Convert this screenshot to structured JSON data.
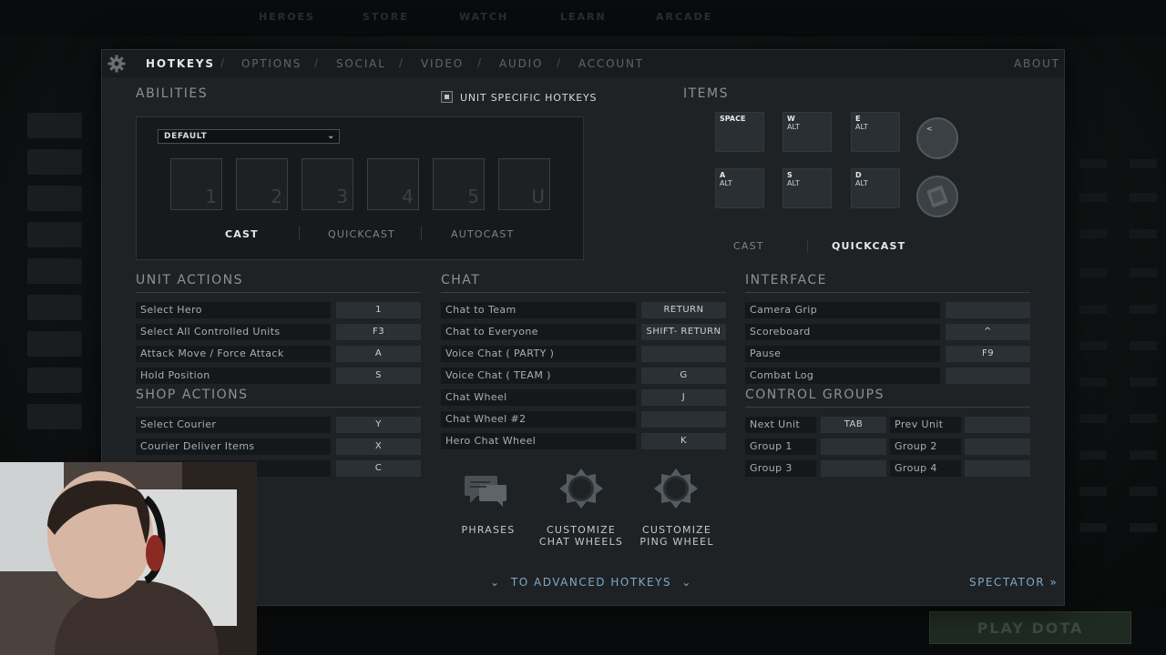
{
  "background": {
    "nav": [
      "HEROES",
      "STORE",
      "WATCH",
      "LEARN",
      "ARCADE"
    ],
    "play_label": "PLAY DOTA"
  },
  "tabs": [
    "HOTKEYS",
    "OPTIONS",
    "SOCIAL",
    "VIDEO",
    "AUDIO",
    "ACCOUNT"
  ],
  "about": "ABOUT",
  "abilities": {
    "title": "ABILITIES",
    "unit_specific": "UNIT SPECIFIC HOTKEYS",
    "preset": "DEFAULT",
    "slots": [
      "1",
      "2",
      "3",
      "4",
      "5",
      "U"
    ],
    "modes": [
      "CAST",
      "QUICKCAST",
      "AUTOCAST"
    ]
  },
  "items": {
    "title": "ITEMS",
    "slots": [
      {
        "key": "SPACE",
        "mod": ""
      },
      {
        "key": "W",
        "mod": "ALT"
      },
      {
        "key": "E",
        "mod": "ALT"
      },
      {
        "key": "A",
        "mod": "ALT"
      },
      {
        "key": "S",
        "mod": "ALT"
      },
      {
        "key": "D",
        "mod": "ALT"
      }
    ],
    "special_key": "<",
    "modes": [
      "CAST",
      "QUICKCAST"
    ]
  },
  "unit_actions": {
    "title": "UNIT ACTIONS",
    "rows": [
      {
        "name": "Select Hero",
        "key": "1"
      },
      {
        "name": "Select All Controlled Units",
        "key": "F3"
      },
      {
        "name": "Attack Move / Force Attack",
        "key": "A"
      },
      {
        "name": "Hold Position",
        "key": "S"
      }
    ]
  },
  "shop_actions": {
    "title": "SHOP ACTIONS",
    "rows": [
      {
        "name": "Select Courier",
        "key": "Y"
      },
      {
        "name": "Courier Deliver Items",
        "key": "X"
      },
      {
        "name": "",
        "key": "C"
      }
    ]
  },
  "chat": {
    "title": "CHAT",
    "rows": [
      {
        "name": "Chat to Team",
        "key": "RETURN"
      },
      {
        "name": "Chat to Everyone",
        "key": "SHIFT- RETURN"
      },
      {
        "name": "Voice Chat ( PARTY )",
        "key": ""
      },
      {
        "name": "Voice Chat ( TEAM )",
        "key": "G"
      },
      {
        "name": "Chat Wheel",
        "key": "J"
      },
      {
        "name": "Chat Wheel #2",
        "key": ""
      },
      {
        "name": "Hero Chat Wheel",
        "key": "K"
      }
    ],
    "actions": [
      {
        "line1": "PHRASES",
        "line2": ""
      },
      {
        "line1": "CUSTOMIZE",
        "line2": "CHAT WHEELS"
      },
      {
        "line1": "CUSTOMIZE",
        "line2": "PING WHEEL"
      }
    ]
  },
  "interface": {
    "title": "INTERFACE",
    "rows": [
      {
        "name": "Camera Grip",
        "key": ""
      },
      {
        "name": "Scoreboard",
        "key": "^"
      },
      {
        "name": "Pause",
        "key": "F9"
      },
      {
        "name": "Combat Log",
        "key": ""
      }
    ]
  },
  "control_groups": {
    "title": "CONTROL GROUPS",
    "rows": [
      {
        "left_name": "Next Unit",
        "left_key": "TAB",
        "right_name": "Prev Unit",
        "right_key": ""
      },
      {
        "left_name": "Group 1",
        "left_key": "",
        "right_name": "Group 2",
        "right_key": ""
      },
      {
        "left_name": "Group 3",
        "left_key": "",
        "right_name": "Group 4",
        "right_key": ""
      }
    ]
  },
  "footer": {
    "advanced": "TO ADVANCED HOTKEYS",
    "spectator": "SPECTATOR"
  },
  "colors": {
    "panel": "#1e2225",
    "link": "#7fa9c7"
  }
}
